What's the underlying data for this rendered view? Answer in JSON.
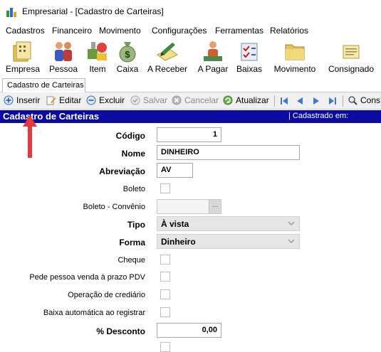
{
  "window": {
    "title": "Empresarial - [Cadastro de Carteiras]"
  },
  "menu": [
    "Cadastros",
    "Financeiro",
    "Movimento",
    "Configurações",
    "Ferramentas",
    "Relatórios"
  ],
  "toolbar": [
    {
      "label": "Empresa",
      "icon": "building-folder-icon"
    },
    {
      "label": "Pessoa",
      "icon": "people-icon"
    },
    {
      "label": "Item",
      "icon": "items-icon"
    },
    {
      "label": "Caixa",
      "icon": "money-bag-icon"
    },
    {
      "label": "A Receber",
      "icon": "receive-pen-icon"
    },
    {
      "label": "A Pagar",
      "icon": "pay-hand-icon"
    },
    {
      "label": "Baixas",
      "icon": "checklist-icon"
    },
    {
      "label": "Movimento",
      "icon": "folder-icon"
    },
    {
      "label": "Consignado",
      "icon": "notepad-icon"
    }
  ],
  "tab": {
    "label": "Cadastro de Carteiras"
  },
  "actions": [
    {
      "label": "Inserir",
      "icon": "add-icon",
      "enabled": true
    },
    {
      "label": "Editar",
      "icon": "edit-icon",
      "enabled": true
    },
    {
      "label": "Excluir",
      "icon": "remove-icon",
      "enabled": true
    },
    {
      "label": "Salvar",
      "icon": "save-check-icon",
      "enabled": false
    },
    {
      "label": "Cancelar",
      "icon": "cancel-icon",
      "enabled": false
    },
    {
      "label": "Atualizar",
      "icon": "refresh-icon",
      "enabled": true
    },
    {
      "label": "Cons",
      "icon": "search-icon",
      "enabled": true
    }
  ],
  "nav_icons": [
    "first-record-icon",
    "previous-record-icon",
    "next-record-icon",
    "last-record-icon"
  ],
  "header": {
    "title": "Cadastro de Carteiras",
    "status": "| Cadastrado em:"
  },
  "form": {
    "codigo": {
      "label": "Código",
      "value": "1"
    },
    "nome": {
      "label": "Nome",
      "value": "DINHEIRO"
    },
    "abreviacao": {
      "label": "Abreviação",
      "value": "AV"
    },
    "boleto": {
      "label": "Boleto"
    },
    "boleto_convenio": {
      "label": "Boleto - Convênio",
      "button": "..."
    },
    "tipo": {
      "label": "Tipo",
      "value": "À vista"
    },
    "forma": {
      "label": "Forma",
      "value": "Dinheiro"
    },
    "cheque": {
      "label": "Cheque"
    },
    "pede_pessoa": {
      "label": "Pede pessoa venda à prazo PDV"
    },
    "operacao_crediario": {
      "label": "Operação de crediário"
    },
    "baixa_automatica": {
      "label": "Baixa automática ao registrar"
    },
    "desconto": {
      "label": "% Desconto",
      "value": "0,00"
    }
  },
  "colors": {
    "header_bg": "#0b0ba3",
    "arrow": "#e8383d",
    "action_bar": "#f0f0f0"
  }
}
